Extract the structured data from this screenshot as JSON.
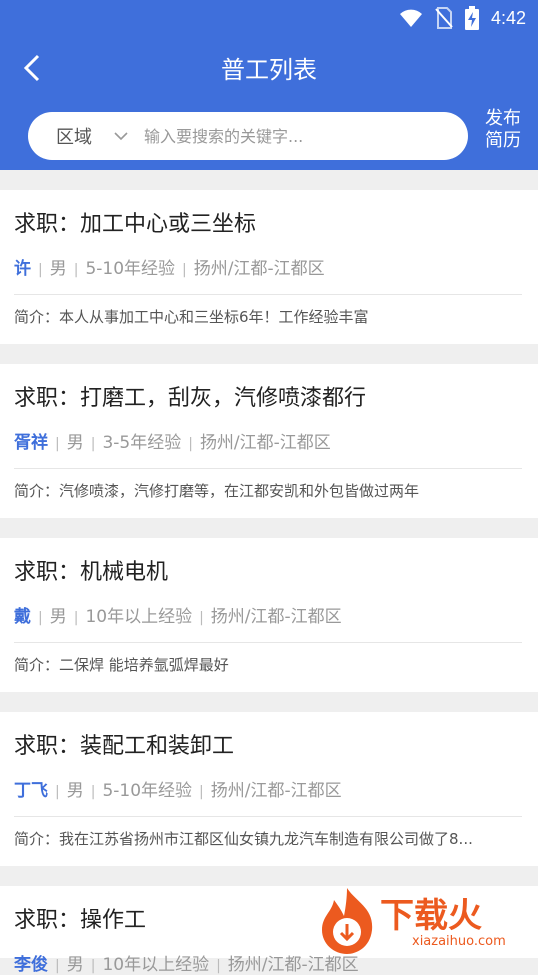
{
  "status_bar": {
    "time": "4:42"
  },
  "header": {
    "title": "普工列表",
    "region_label": "区域",
    "search_placeholder": "输入要搜索的关键字...",
    "publish_line1": "发布",
    "publish_line2": "简历"
  },
  "jobs": [
    {
      "title": "求职：加工中心或三坐标",
      "name": "许",
      "gender": "男",
      "experience": "5-10年经验",
      "location": "扬州/江都-江都区",
      "intro": "简介：本人从事加工中心和三坐标6年！工作经验丰富"
    },
    {
      "title": "求职：打磨工，刮灰，汽修喷漆都行",
      "name": "胥祥",
      "gender": "男",
      "experience": "3-5年经验",
      "location": "扬州/江都-江都区",
      "intro": "简介：汽修喷漆，汽修打磨等，在江都安凯和外包皆做过两年"
    },
    {
      "title": "求职：机械电机",
      "name": "戴",
      "gender": "男",
      "experience": "10年以上经验",
      "location": "扬州/江都-江都区",
      "intro": "简介：二保焊 能培养氩弧焊最好"
    },
    {
      "title": "求职：装配工和装卸工",
      "name": "丁飞",
      "gender": "男",
      "experience": "5-10年经验",
      "location": "扬州/江都-江都区",
      "intro": "简介：我在江苏省扬州市江都区仙女镇九龙汽车制造有限公司做了8..."
    },
    {
      "title": "求职：操作工",
      "name": "李俊",
      "gender": "男",
      "experience": "10年以上经验",
      "location": "扬州/江都-江都区",
      "intro": ""
    }
  ],
  "watermark": {
    "text": "下载火",
    "url": "xiazaihuo.com"
  },
  "colors": {
    "primary": "#3f6fdb",
    "watermark": "#ec5a1f"
  }
}
